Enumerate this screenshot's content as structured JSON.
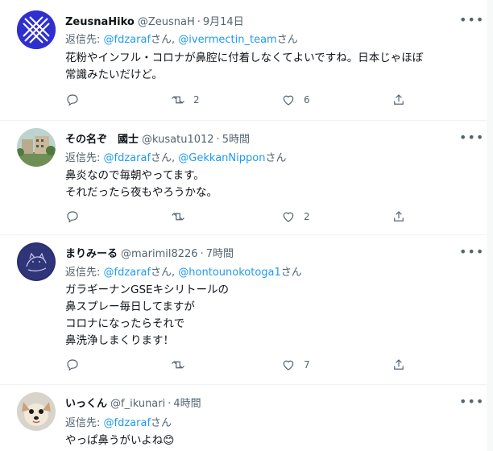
{
  "tweets": [
    {
      "name": "ZeusnaHiko",
      "handle": "@ZeusnaH",
      "time": "9月14日",
      "reply_prefix": "返信先: ",
      "reply_to": [
        "@fdzaraf",
        "@ivermectin_team"
      ],
      "reply_sep": "さん, ",
      "reply_suffix": "さん",
      "text": "花粉やインフル・コロナが鼻腔に付着しなくてよいですね。日本じゃほぼ\n常識みたいだけど。",
      "retweets": "2",
      "likes": "6"
    },
    {
      "name": "その名ぞ　國士",
      "handle": "@kusatu1012",
      "time": "5時間",
      "reply_prefix": "返信先: ",
      "reply_to": [
        "@fdzaraf",
        "@GekkanNippon"
      ],
      "reply_sep": "さん, ",
      "reply_suffix": "さん",
      "text": "鼻炎なので毎朝やってます。\nそれだったら夜もやろうかな。",
      "retweets": "",
      "likes": "2"
    },
    {
      "name": "まりみーる",
      "handle": "@marimil8226",
      "time": "7時間",
      "reply_prefix": "返信先: ",
      "reply_to": [
        "@fdzaraf",
        "@hontounokotoga1"
      ],
      "reply_sep": "さん, ",
      "reply_suffix": "さん",
      "text": "ガラギーナンGSEキシリトールの\n鼻スプレー毎日してますが\nコロナになったらそれで\n鼻洗浄しまくります！",
      "retweets": "",
      "likes": "7"
    },
    {
      "name": "いっくん",
      "handle": "@f_ikunari",
      "time": "4時間",
      "reply_prefix": "返信先: ",
      "reply_to": [
        "@fdzaraf"
      ],
      "reply_sep": "",
      "reply_suffix": "さん",
      "text": "やっぱ鼻うがいよね😊",
      "retweets": "",
      "likes": ""
    }
  ],
  "dot": "·",
  "more_glyph": "•••",
  "colors": {
    "link": "#1d9bf0",
    "secondary": "#536471",
    "text": "#0f1419"
  },
  "icons": [
    "reply-icon",
    "retweet-icon",
    "like-icon",
    "share-icon",
    "more-icon"
  ]
}
